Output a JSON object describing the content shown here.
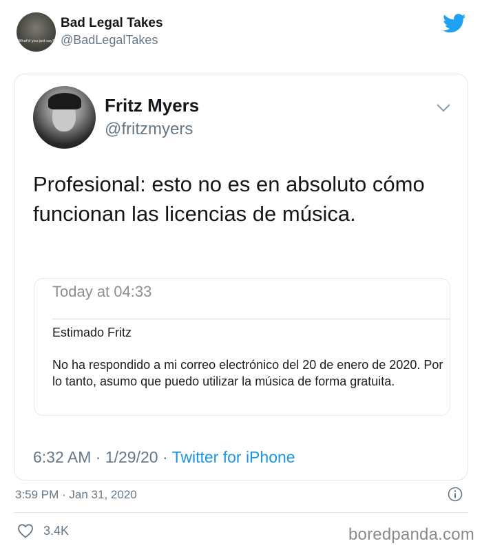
{
  "outer_tweet": {
    "display_name": "Bad Legal Takes",
    "handle": "@BadLegalTakes",
    "avatar_caption": "What'd you just say?",
    "timestamp": "3:59 PM · Jan 31, 2020",
    "like_count": "3.4K"
  },
  "quoted_tweet": {
    "display_name": "Fritz Myers",
    "handle": "@fritzmyers",
    "text": "Profesional: esto no es en absoluto cómo funcionan las licencias de música.",
    "time_date": "6:32 AM · 1/29/20 · ",
    "source": "Twitter for iPhone"
  },
  "email": {
    "time": "Today at 04:33",
    "greeting": "Estimado Fritz",
    "body": "No ha respondido a mi correo electrónico del 20 de enero de 2020. Por lo tanto, asumo que puedo utilizar la música de forma gratuita."
  },
  "watermark": "boredpanda.com",
  "colors": {
    "twitter_blue": "#1da1f2",
    "link_blue": "#1b95e0",
    "secondary_text": "#657786",
    "border": "#e1e8ed"
  },
  "icons": [
    "twitter-bird-icon",
    "chevron-down-icon",
    "info-icon",
    "heart-icon"
  ]
}
